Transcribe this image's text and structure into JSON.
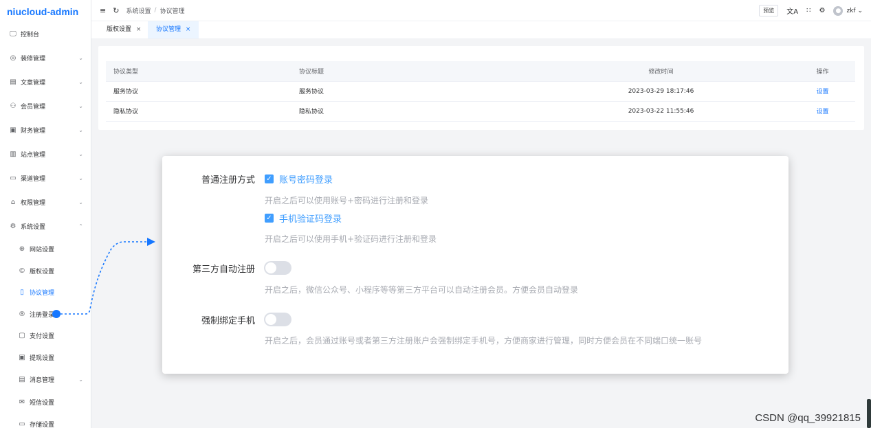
{
  "app": {
    "brand": "niucloud-admin"
  },
  "sidebar": {
    "items": [
      {
        "label": "控制台",
        "icon": "monitor-icon",
        "glyph": "🖵"
      },
      {
        "label": "装修管理",
        "icon": "palette-icon",
        "glyph": "◎",
        "arrow": "⌄"
      },
      {
        "label": "文章管理",
        "icon": "document-icon",
        "glyph": "▤",
        "arrow": "⌄"
      },
      {
        "label": "会员管理",
        "icon": "users-icon",
        "glyph": "⚇",
        "arrow": "⌄"
      },
      {
        "label": "财务管理",
        "icon": "wallet-icon",
        "glyph": "▣",
        "arrow": "⌄"
      },
      {
        "label": "站点管理",
        "icon": "building-icon",
        "glyph": "▥",
        "arrow": "⌄"
      },
      {
        "label": "渠道管理",
        "icon": "channel-icon",
        "glyph": "▭",
        "arrow": "⌄"
      },
      {
        "label": "权限管理",
        "icon": "lock-icon",
        "glyph": "⌂",
        "arrow": "⌄"
      },
      {
        "label": "系统设置",
        "icon": "gear-icon",
        "glyph": "⚙",
        "arrow": "⌃"
      },
      {
        "label": "网站设置",
        "icon": "globe-icon",
        "glyph": "⊕",
        "sub": true
      },
      {
        "label": "版权设置",
        "icon": "copyright-icon",
        "glyph": "©",
        "sub": true
      },
      {
        "label": "协议管理",
        "icon": "agreement-icon",
        "glyph": "▯",
        "sub": true,
        "active": true
      },
      {
        "label": "注册登录",
        "icon": "register-icon",
        "glyph": "®",
        "sub": true
      },
      {
        "label": "支付设置",
        "icon": "pay-icon",
        "glyph": "▢",
        "sub": true
      },
      {
        "label": "提现设置",
        "icon": "withdraw-icon",
        "glyph": "▣",
        "sub": true
      },
      {
        "label": "消息管理",
        "icon": "message-icon",
        "glyph": "▤",
        "sub": true,
        "arrow": "⌄"
      },
      {
        "label": "短信设置",
        "icon": "sms-icon",
        "glyph": "✉",
        "sub": true
      },
      {
        "label": "存储设置",
        "icon": "storage-icon",
        "glyph": "▭",
        "sub": true
      }
    ]
  },
  "header": {
    "menu_icon": "≡",
    "refresh_icon": "↻",
    "breadcrumb": [
      "系统设置",
      "协议管理"
    ],
    "breadcrumb_sep": "/",
    "preview_label": "预览",
    "lang_icon": "文A",
    "apps_icon": "∷",
    "settings_icon": "⚙",
    "avatar_glyph": "●",
    "user": "zkf",
    "user_arrow": "⌄"
  },
  "tabs": [
    {
      "label": "版权设置",
      "close": "×"
    },
    {
      "label": "协议管理",
      "close": "×",
      "active": true
    }
  ],
  "agreements": {
    "columns": [
      "协议类型",
      "协议标题",
      "修改时间",
      "操作"
    ],
    "rows": [
      {
        "type": "服务协议",
        "title": "服务协议",
        "time": "2023-03-29 18:17:46",
        "action": "设置"
      },
      {
        "type": "隐私协议",
        "title": "隐私协议",
        "time": "2023-03-22 11:55:46",
        "action": "设置"
      }
    ]
  },
  "register_panel": {
    "normal_label": "普通注册方式",
    "check_mark": "✓",
    "option_password": "账号密码登录",
    "hint_password": "开启之后可以使用账号+密码进行注册和登录",
    "option_mobile": "手机验证码登录",
    "hint_mobile": "开启之后可以使用手机+验证码进行注册和登录",
    "third_party_label": "第三方自动注册",
    "third_party_hint": "开启之后，微信公众号、小程序等等第三方平台可以自动注册会员。方便会员自动登录",
    "bind_mobile_label": "强制绑定手机",
    "bind_mobile_hint": "开启之后，会员通过账号或者第三方注册账户会强制绑定手机号，方便商家进行管理，同时方便会员在不同端口统一账号",
    "password_checked": true,
    "mobile_checked": true,
    "third_party_on": false,
    "bind_mobile_on": false
  },
  "watermark": "CSDN @qq_39921815",
  "colors": {
    "accent": "#1677ff",
    "checkbox": "#409eff",
    "annotation": "#1677ff"
  }
}
